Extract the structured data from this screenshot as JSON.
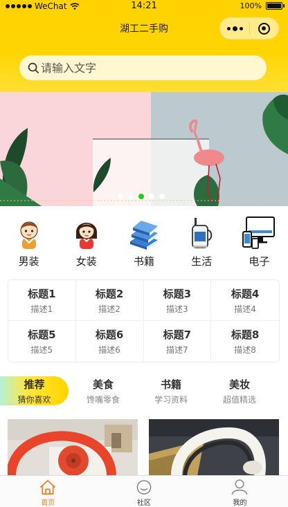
{
  "status_bar": {
    "carrier": "WeChat",
    "time": "14:21",
    "battery": "100%"
  },
  "nav": {
    "title": "湖工二手购",
    "more_icon": "more-dots-icon",
    "close_icon": "target-close-icon"
  },
  "search": {
    "placeholder": "请输入文字",
    "icon": "search-icon"
  },
  "banner": {
    "dot_count": 5,
    "active_dot": 3
  },
  "categories": [
    {
      "label": "男装",
      "icon": "boy-avatar-icon"
    },
    {
      "label": "女装",
      "icon": "girl-avatar-icon"
    },
    {
      "label": "书籍",
      "icon": "books-icon"
    },
    {
      "label": "生活",
      "icon": "mug-icon"
    },
    {
      "label": "电子",
      "icon": "devices-icon"
    }
  ],
  "grid": [
    {
      "title": "标题1",
      "desc": "描述1"
    },
    {
      "title": "标题2",
      "desc": "描述2"
    },
    {
      "title": "标题3",
      "desc": "描述3"
    },
    {
      "title": "标题4",
      "desc": "描述4"
    },
    {
      "title": "标题5",
      "desc": "描述5"
    },
    {
      "title": "标题6",
      "desc": "描述6"
    },
    {
      "title": "标题7",
      "desc": "描述7"
    },
    {
      "title": "标题8",
      "desc": "描述8"
    }
  ],
  "tabs": [
    {
      "title": "推荐",
      "sub": "猜你喜欢",
      "active": true
    },
    {
      "title": "美食",
      "sub": "馋嘴零食"
    },
    {
      "title": "书籍",
      "sub": "学习资料"
    },
    {
      "title": "美妆",
      "sub": "超值精选"
    }
  ],
  "tabbar": [
    {
      "label": "首页",
      "icon": "home-icon",
      "active": true
    },
    {
      "label": "社区",
      "icon": "smile-icon"
    },
    {
      "label": "我的",
      "icon": "person-icon"
    }
  ],
  "colors": {
    "brand_yellow": "#ffd200",
    "active_orange": "#f07c1a",
    "indicator_green": "#22cc22"
  }
}
